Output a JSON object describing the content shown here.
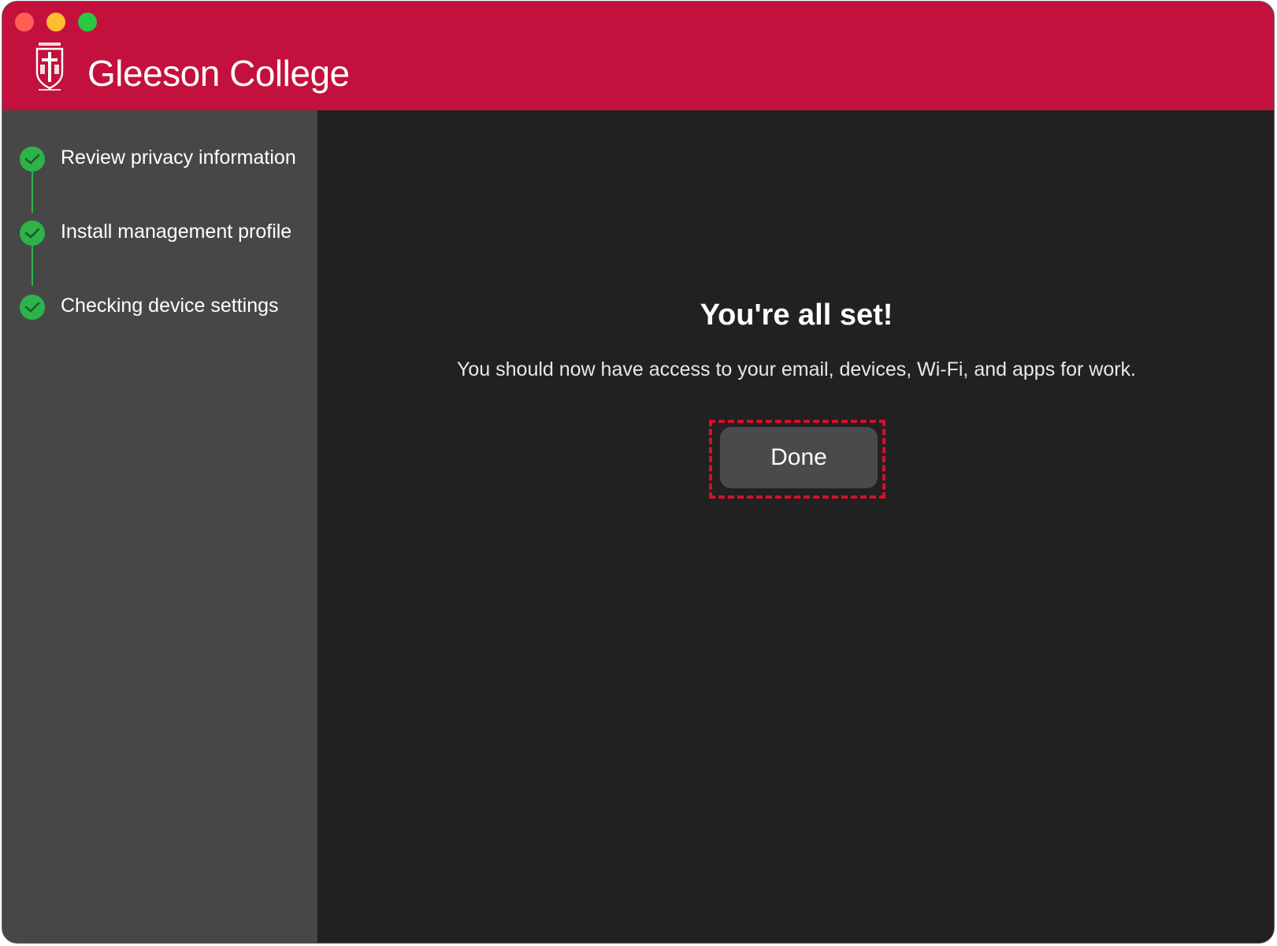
{
  "window": {
    "controls": [
      "close",
      "minimize",
      "maximize"
    ]
  },
  "header": {
    "title": "Gleeson College",
    "logo_icon": "gleeson-crest-logo",
    "background_color": "#c4103c"
  },
  "sidebar": {
    "steps": [
      {
        "label": "Review privacy information",
        "status": "complete",
        "icon": "check-circle-icon"
      },
      {
        "label": "Install management profile",
        "status": "complete",
        "icon": "check-circle-icon"
      },
      {
        "label": "Checking device settings",
        "status": "complete",
        "icon": "check-circle-icon"
      }
    ],
    "accent_color": "#2db34a"
  },
  "main": {
    "title": "You're all set!",
    "subtitle": "You should now have access to your email, devices, Wi-Fi, and apps for work.",
    "done_label": "Done"
  }
}
